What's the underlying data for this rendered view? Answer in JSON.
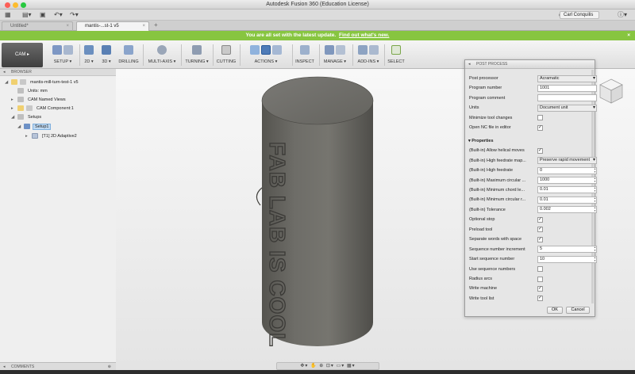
{
  "window": {
    "title": "Autodesk Fusion 360 (Education License)"
  },
  "toolbar": {
    "user_name": "Carl Conquilis",
    "help_icon": "question-icon",
    "clock_icon": "clock-icon"
  },
  "tabs": [
    {
      "label": "Untitled*"
    },
    {
      "label": "mantis-...st-1 v5"
    }
  ],
  "notification": {
    "text": "You are all set with the latest update.",
    "link": "Find out what's new."
  },
  "ribbon": {
    "workspace": "CAM ▸",
    "groups": [
      {
        "label": "SETUP ▾"
      },
      {
        "label": "2D ▾"
      },
      {
        "label": "3D ▾"
      },
      {
        "label": "DRILLING"
      },
      {
        "label": "MULTI-AXIS ▾"
      },
      {
        "label": "TURNING ▾"
      },
      {
        "label": "CUTTING"
      },
      {
        "label": "ACTIONS ▾"
      },
      {
        "label": "INSPECT"
      },
      {
        "label": "MANAGE ▾"
      },
      {
        "label": "ADD-INS ▾"
      },
      {
        "label": "SELECT"
      }
    ]
  },
  "browser": {
    "title": "BROWSER",
    "items": [
      {
        "label": "mantis-mill-turn-test-1 v5"
      },
      {
        "label": "Units: mm"
      },
      {
        "label": "CAM Named Views"
      },
      {
        "label": "CAM Component:1"
      },
      {
        "label": "Setups"
      },
      {
        "label": "Setup1"
      },
      {
        "label": "[T1] 2D Adaptive2"
      }
    ]
  },
  "comments": {
    "label": "COMMENTS"
  },
  "model": {
    "engraving": "FAB LAB IS COOL"
  },
  "post_process": {
    "title": "POST PROCESS",
    "top_rows": [
      {
        "label": "Post processor",
        "type": "select",
        "value": "Acramatic"
      },
      {
        "label": "Program number",
        "type": "text",
        "value": "1001"
      },
      {
        "label": "Program comment",
        "type": "text",
        "value": ""
      },
      {
        "label": "Units",
        "type": "select",
        "value": "Document unit"
      },
      {
        "label": "Minimize tool changes",
        "type": "check",
        "checked": false
      },
      {
        "label": "Open NC file in editor",
        "type": "check",
        "checked": true
      }
    ],
    "properties_label": "Properties",
    "properties": [
      {
        "label": "(Built-in) Allow helical moves",
        "type": "check",
        "checked": true
      },
      {
        "label": "(Built-in) High feedrate map...",
        "type": "select",
        "value": "Preserve rapid movement"
      },
      {
        "label": "(Built-in) High feedrate",
        "type": "spin",
        "value": "0"
      },
      {
        "label": "(Built-in) Maximum circular ...",
        "type": "spin",
        "value": "1000"
      },
      {
        "label": "(Built-in) Minimum chord le...",
        "type": "spin",
        "value": "0.01"
      },
      {
        "label": "(Built-in) Minimum circular r...",
        "type": "spin",
        "value": "0.01"
      },
      {
        "label": "(Built-in) Tolerance",
        "type": "spin",
        "value": "0.002"
      },
      {
        "label": "Optional stop",
        "type": "check",
        "checked": true
      },
      {
        "label": "Preload tool",
        "type": "check",
        "checked": true
      },
      {
        "label": "Separate words with space",
        "type": "check",
        "checked": true
      },
      {
        "label": "Sequence number increment",
        "type": "spin",
        "value": "5"
      },
      {
        "label": "Start sequence number",
        "type": "spin",
        "value": "10"
      },
      {
        "label": "Use sequence numbers",
        "type": "check",
        "checked": false
      },
      {
        "label": "Radius arcs",
        "type": "check",
        "checked": false
      },
      {
        "label": "Write machine",
        "type": "check",
        "checked": true
      },
      {
        "label": "Write tool list",
        "type": "check",
        "checked": true
      }
    ],
    "ok_label": "OK",
    "cancel_label": "Cancel"
  },
  "colors": {
    "notice_green": "#87c540",
    "cylinder": "#6f6f6a",
    "selection": "#bfd9f2"
  }
}
